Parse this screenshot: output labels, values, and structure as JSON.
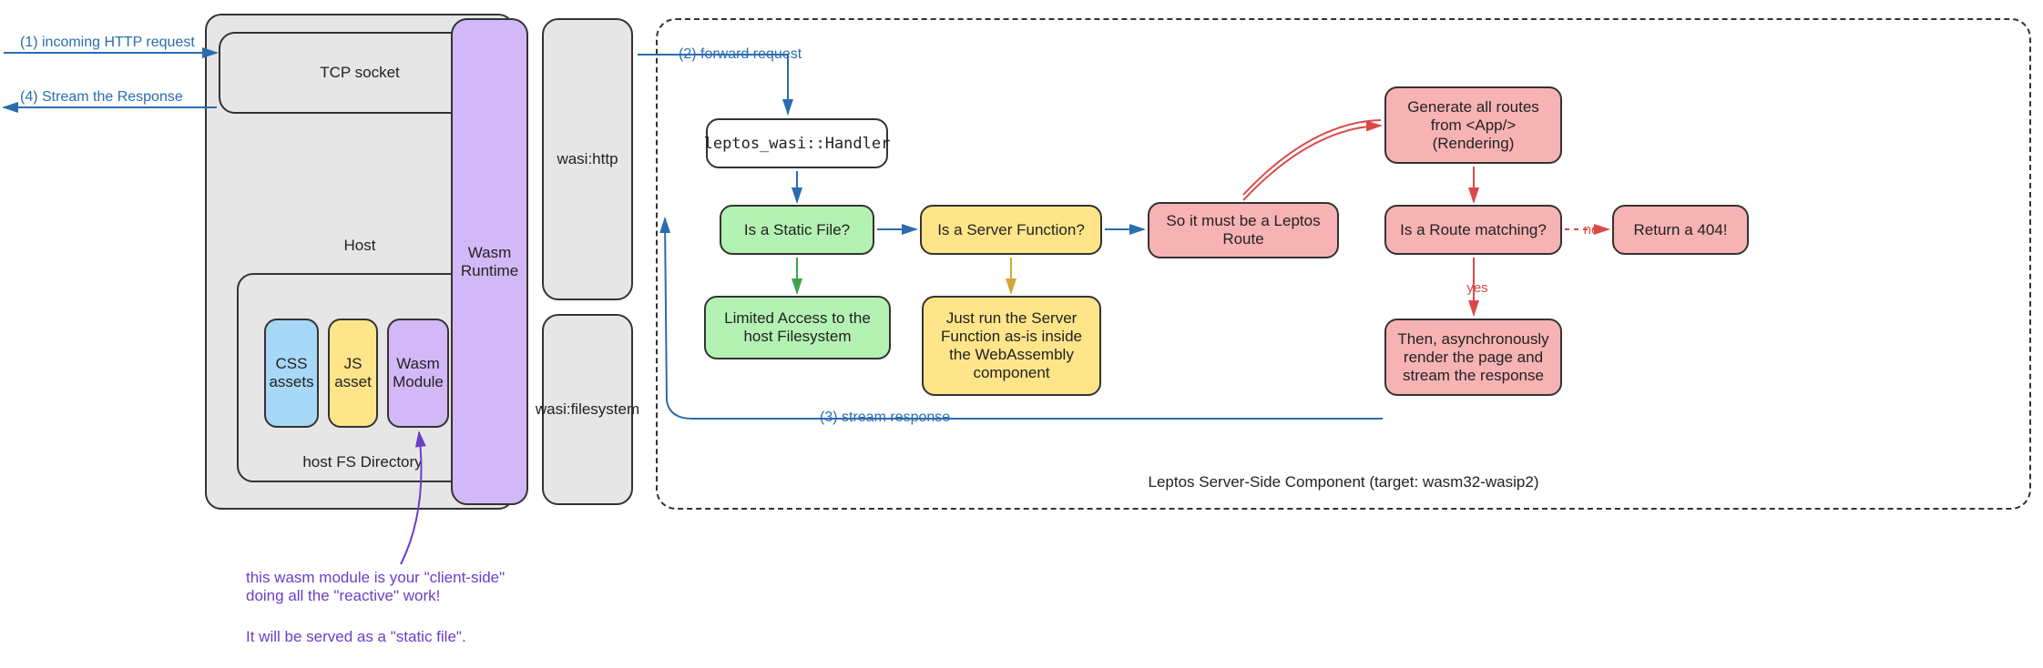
{
  "arrows": {
    "incoming_http": "(1) incoming HTTP request",
    "stream_response_out": "(4) Stream the Response",
    "forward_request": "(2) forward request",
    "stream_response_back": "(3) stream response"
  },
  "host_panel": {
    "tcp_socket": "TCP socket",
    "host_label": "Host",
    "host_fs_dir": "host FS Directory",
    "css_assets": "CSS\nassets",
    "js_asset": "JS\nasset",
    "wasm_module": "Wasm\nModule"
  },
  "runtime": {
    "wasm_runtime": "Wasm\nRuntime",
    "wasi_http": "wasi:http",
    "wasi_filesystem": "wasi:filesystem"
  },
  "leptos": {
    "handler": "leptos_wasi::Handler",
    "static_file_q": "Is a Static File?",
    "fs_access": "Limited Access to the\nhost Filesystem",
    "server_fn_q": "Is a Server Function?",
    "server_fn_run": "Just run the Server\nFunction as-is inside\nthe WebAssembly\ncomponent",
    "must_be_route": "So it must be a Leptos\nRoute",
    "generate_routes": "Generate all routes\nfrom <App/>\n(Rendering)",
    "route_match_q": "Is a Route matching?",
    "return_404": "Return a 404!",
    "render_stream": "Then, asynchronously\nrender the page and\nstream the response",
    "yes": "yes",
    "no": "no",
    "container_label": "Leptos Server-Side Component (target: wasm32-wasip2)"
  },
  "annotation": {
    "line1": "this wasm module is your \"client-side\"\ndoing all the \"reactive\" work!",
    "line2": "It will be served as a \"static file\"."
  }
}
